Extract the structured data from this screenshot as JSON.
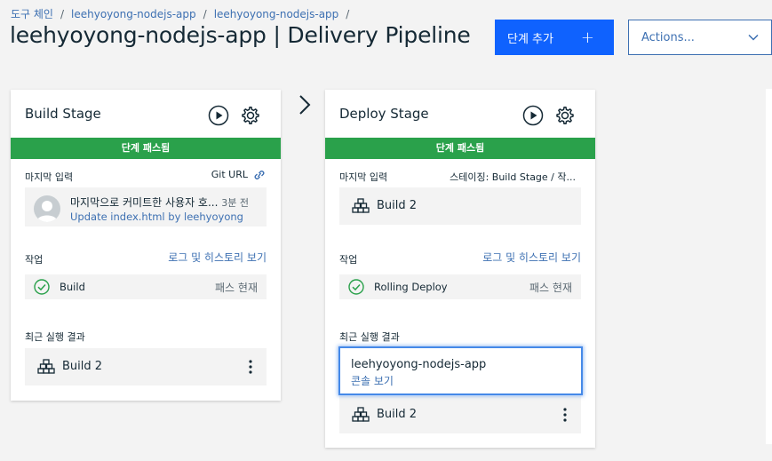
{
  "breadcrumb": [
    "도구 체인",
    "leehyoyong-nodejs-app",
    "leehyoyong-nodejs-app"
  ],
  "breadcrumb_sep": "/",
  "page_title": "leehyoyong-nodejs-app | Delivery Pipeline",
  "header": {
    "add_stage_label": "단계 추가",
    "add_stage_icon": "+",
    "actions_label": "Actions..."
  },
  "colors": {
    "primary": "#0f62fe",
    "link": "#3d70b2",
    "success": "#2aa14b",
    "background": "#f3f3f3"
  },
  "stages": [
    {
      "title": "Build Stage",
      "status": "단계 패스됨",
      "input_label": "마지막 입력",
      "input_meta": "Git URL",
      "input_meta_icon": "link-icon",
      "commit": {
        "text": "마지막으로 커미트한 사용자 호...",
        "time": "3분 전",
        "link": "Update index.html by leehyoyong"
      },
      "jobs_label": "작업",
      "jobs_link": "로그 및 히스토리 보기",
      "job": {
        "name": "Build",
        "state": "패스 현재"
      },
      "recent_label": "최근 실행 결과",
      "recent": {
        "name": "Build 2"
      }
    },
    {
      "title": "Deploy Stage",
      "status": "단계 패스됨",
      "input_label": "마지막 입력",
      "input_meta": "스테이징: Build Stage  /  작...",
      "input_build": "Build 2",
      "jobs_label": "작업",
      "jobs_link": "로그 및 히스토리 보기",
      "job": {
        "name": "Rolling Deploy",
        "state": "패스 현재"
      },
      "recent_label": "최근 실행 결과",
      "popover": {
        "app": "leehyoyong-nodejs-app",
        "link": "콘솔 보기"
      },
      "recent": {
        "name": "Build 2"
      }
    }
  ]
}
